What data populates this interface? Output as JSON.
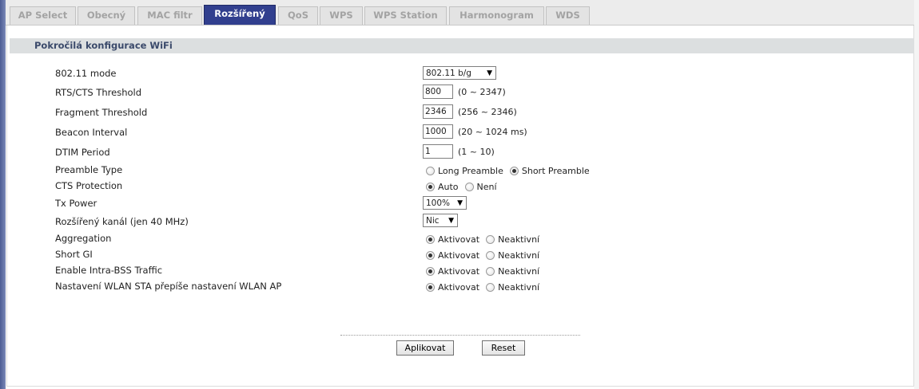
{
  "tabs": [
    {
      "label": "AP Select",
      "active": false
    },
    {
      "label": "Obecný",
      "active": false
    },
    {
      "label": "MAC filtr",
      "active": false
    },
    {
      "label": "Rozšířený",
      "active": true
    },
    {
      "label": "QoS",
      "active": false
    },
    {
      "label": "WPS",
      "active": false
    },
    {
      "label": "WPS Station",
      "active": false
    },
    {
      "label": "Harmonogram",
      "active": false
    },
    {
      "label": "WDS",
      "active": false
    }
  ],
  "section": {
    "title": "Pokročilá konfigurace WiFi"
  },
  "fields": {
    "mode": {
      "label": "802.11 mode",
      "value": "802.11 b/g"
    },
    "rts": {
      "label": "RTS/CTS Threshold",
      "value": "800",
      "hint": "(0 ~ 2347)"
    },
    "frag": {
      "label": "Fragment Threshold",
      "value": "2346",
      "hint": "(256 ~ 2346)"
    },
    "beacon": {
      "label": "Beacon Interval",
      "value": "1000",
      "hint": "(20 ~ 1024 ms)"
    },
    "dtim": {
      "label": "DTIM Period",
      "value": "1",
      "hint": "(1 ~ 10)"
    },
    "preamble": {
      "label": "Preamble Type",
      "opt1": "Long Preamble",
      "opt2": "Short Preamble",
      "selected": "Short Preamble"
    },
    "cts": {
      "label": "CTS Protection",
      "opt1": "Auto",
      "opt2": "Není",
      "selected": "Auto"
    },
    "txpower": {
      "label": "Tx Power",
      "value": "100%"
    },
    "extchan": {
      "label": "Rozšířený kanál (jen 40 MHz)",
      "value": "Nic"
    },
    "aggregation": {
      "label": "Aggregation",
      "opt1": "Aktivovat",
      "opt2": "Neaktivní",
      "selected": "Aktivovat"
    },
    "shortgi": {
      "label": "Short GI",
      "opt1": "Aktivovat",
      "opt2": "Neaktivní",
      "selected": "Aktivovat"
    },
    "intrabss": {
      "label": "Enable Intra-BSS Traffic",
      "opt1": "Aktivovat",
      "opt2": "Neaktivní",
      "selected": "Aktivovat"
    },
    "wlansta": {
      "label": "Nastavení WLAN STA přepíše nastavení WLAN AP",
      "opt1": "Aktivovat",
      "opt2": "Neaktivní",
      "selected": "Aktivovat"
    }
  },
  "buttons": {
    "apply": "Aplikovat",
    "reset": "Reset"
  },
  "colors": {
    "active_tab": "#313f8e",
    "section_bg": "#dcdfe0"
  }
}
